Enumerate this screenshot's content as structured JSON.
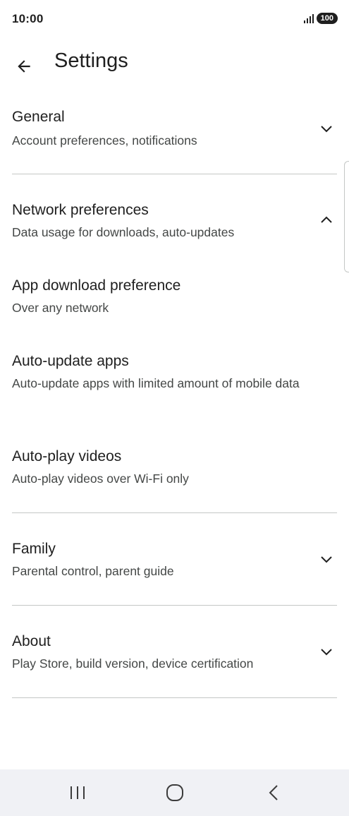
{
  "status_bar": {
    "time": "10:00",
    "battery": "100"
  },
  "header": {
    "title": "Settings"
  },
  "sections": {
    "general": {
      "title": "General",
      "subtitle": "Account preferences, notifications"
    },
    "network": {
      "title": "Network preferences",
      "subtitle": "Data usage for downloads, auto-updates",
      "items": [
        {
          "title": "App download preference",
          "subtitle": "Over any network"
        },
        {
          "title": "Auto-update apps",
          "subtitle": "Auto-update apps with limited amount of mobile data"
        },
        {
          "title": "Auto-play videos",
          "subtitle": "Auto-play videos over Wi-Fi only"
        }
      ]
    },
    "family": {
      "title": "Family",
      "subtitle": "Parental control, parent guide"
    },
    "about": {
      "title": "About",
      "subtitle": "Play Store, build version, device certification"
    }
  },
  "icons": {
    "back": "arrow-left-icon",
    "expand": "chevron-down-icon",
    "collapse": "chevron-up-icon",
    "nav_recents": "recents-icon",
    "nav_home": "home-icon",
    "nav_back": "back-icon"
  }
}
